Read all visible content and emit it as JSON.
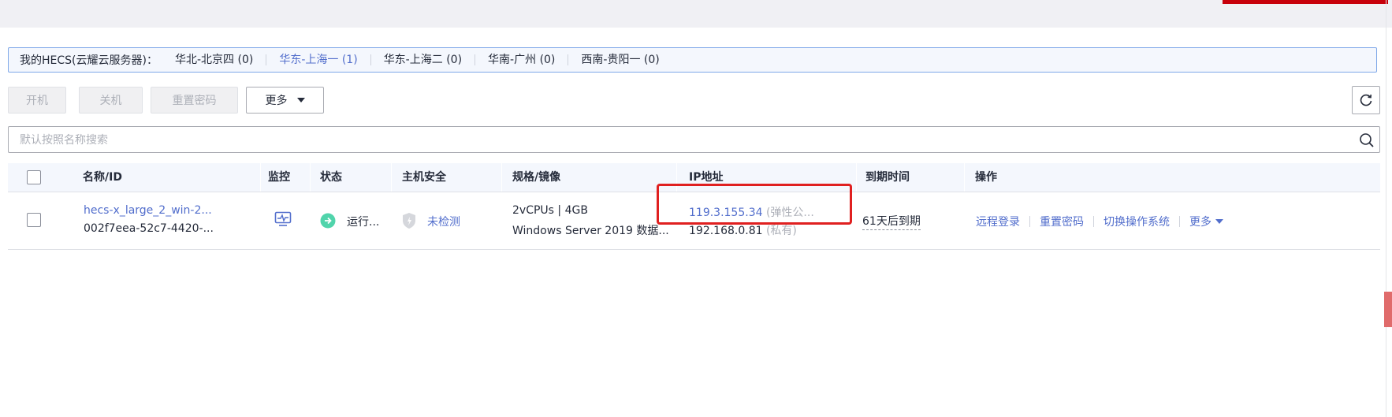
{
  "regions": {
    "label": "我的HECS(云耀云服务器)：",
    "items": [
      {
        "name": "华北-北京四",
        "count": "(0)",
        "active": false
      },
      {
        "name": "华东-上海一",
        "count": "(1)",
        "active": true
      },
      {
        "name": "华东-上海二",
        "count": "(0)",
        "active": false
      },
      {
        "name": "华南-广州",
        "count": "(0)",
        "active": false
      },
      {
        "name": "西南-贵阳一",
        "count": "(0)",
        "active": false
      }
    ]
  },
  "toolbar": {
    "start": "开机",
    "stop": "关机",
    "reset_password": "重置密码",
    "more": "更多"
  },
  "search": {
    "placeholder": "默认按照名称搜索"
  },
  "table": {
    "headers": {
      "name_id": "名称/ID",
      "monitor": "监控",
      "status": "状态",
      "host_security": "主机安全",
      "spec_image": "规格/镜像",
      "ip": "IP地址",
      "expiry": "到期时间",
      "actions": "操作"
    },
    "rows": [
      {
        "name": "hecs-x_large_2_win-2...",
        "id": "002f7eea-52c7-4420-...",
        "status": "运行...",
        "security": "未检测",
        "spec": "2vCPUs | 4GB",
        "image": "Windows Server 2019 数据...",
        "public_ip": "119.3.155.34",
        "public_ip_type": "(弹性公...",
        "private_ip": "192.168.0.81",
        "private_ip_type": "(私有)",
        "expiry": "61天后到期",
        "actions": {
          "remote_login": "远程登录",
          "reset_password": "重置密码",
          "switch_os": "切换操作系统",
          "more": "更多"
        }
      }
    ]
  },
  "colors": {
    "link": "#526ecc",
    "highlight": "#e02020",
    "status_running": "#50d4ab"
  }
}
